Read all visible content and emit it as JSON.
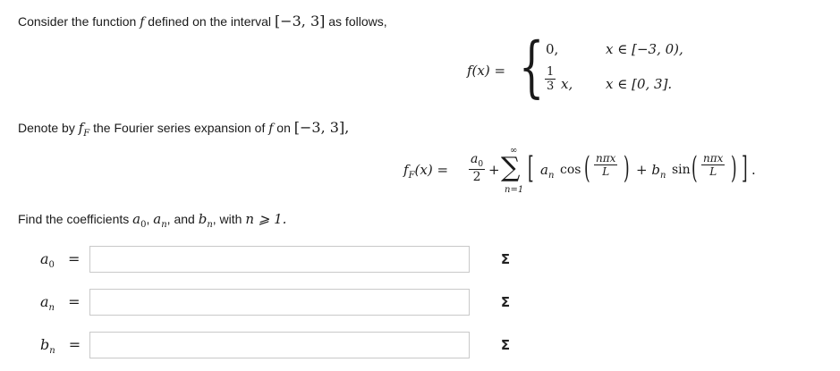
{
  "intro": {
    "text_before_f": "Consider the function ",
    "f_symbol": "f",
    "text_after_f": " defined on the interval ",
    "interval": "[−3, 3]",
    "text_end": " as follows,"
  },
  "piecewise": {
    "lhs": "f(x) =",
    "case1_value": "0,",
    "case1_cond": "x ∈ [−3, 0),",
    "case2_num": "1",
    "case2_den": "3",
    "case2_var": "x,",
    "case2_cond": "x ∈ [0, 3]."
  },
  "denote": {
    "text_before": "Denote by ",
    "fF": "f",
    "fF_sub": "F",
    "text_middle": " the Fourier series expansion of ",
    "f_symbol": "f",
    "text_on": " on ",
    "interval": "[−3, 3],"
  },
  "series": {
    "lhs_f": "f",
    "lhs_sub": "F",
    "lhs_arg": "(x) =",
    "a0_num": "a",
    "a0_sub": "0",
    "a0_den": "2",
    "plus": "+",
    "sum_upper": "∞",
    "sum_symbol": "∑",
    "sum_lower": "n=1",
    "an": "a",
    "n_sub": "n",
    "cos": "cos",
    "arg_num": "nπx",
    "arg_den": "L",
    "plus_bn": "+ b",
    "sin": "sin",
    "tail": "."
  },
  "find": {
    "text_before": "Find the coefficients ",
    "a0": "a",
    "a0_sub": "0",
    "comma1": ", ",
    "an": "a",
    "an_sub": "n",
    "comma2": ", and ",
    "bn": "b",
    "bn_sub": "n",
    "text_with": ", with ",
    "condition": "n ⩾ 1."
  },
  "answers": [
    {
      "var": "a",
      "sub": "0",
      "eq": "=",
      "value": "",
      "sigma": "Σ"
    },
    {
      "var": "a",
      "sub": "n",
      "eq": "=",
      "value": "",
      "sigma": "Σ"
    },
    {
      "var": "b",
      "sub": "n",
      "eq": "=",
      "value": "",
      "sigma": "Σ"
    }
  ]
}
